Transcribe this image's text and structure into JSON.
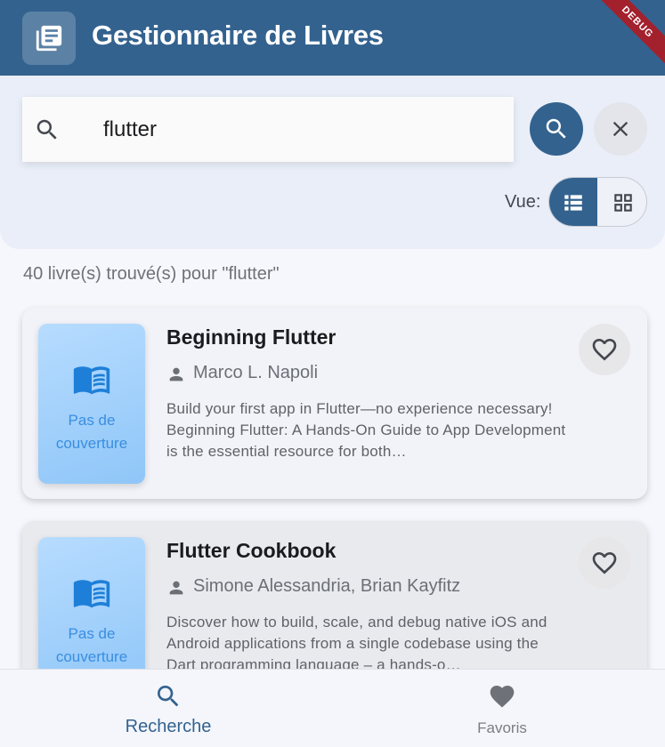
{
  "app": {
    "title": "Gestionnaire de Livres",
    "icon": "library-books-icon",
    "debug_label": "DEBUG"
  },
  "search": {
    "value": "flutter",
    "placeholder": "",
    "view_label": "Vue:",
    "view_mode": "list"
  },
  "results": {
    "summary": "40 livre(s) trouvé(s) pour \"flutter\""
  },
  "books": [
    {
      "title": "Beginning Flutter",
      "authors": "Marco L. Napoli",
      "description": "Build your first app in Flutter—no experience necessary! Beginning Flutter: A Hands-On Guide to App Development is the essential resource for both…",
      "cover_text": "Pas de couverture",
      "favorite": false
    },
    {
      "title": "Flutter Cookbook",
      "authors": "Simone Alessandria, Brian Kayfitz",
      "description": "Discover how to build, scale, and debug native iOS and Android applications from a single codebase using the Dart programming language – a hands-o…",
      "cover_text": "Pas de couverture",
      "favorite": false
    }
  ],
  "nav": {
    "search_label": "Recherche",
    "favorites_label": "Favoris",
    "active": "search"
  },
  "colors": {
    "primary": "#33628f",
    "cover_gradient_start": "#b7dcff",
    "cover_text": "#3a8ee0",
    "debug": "#a3202d"
  }
}
